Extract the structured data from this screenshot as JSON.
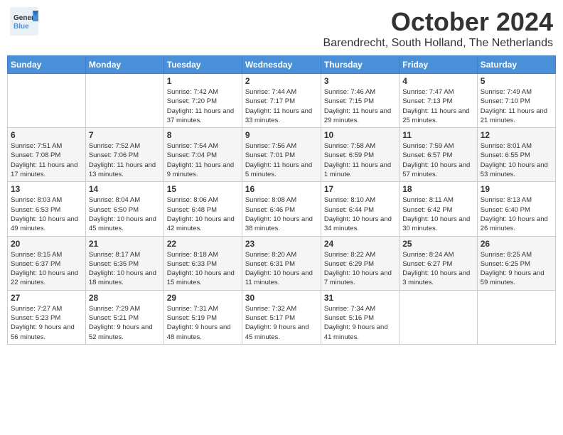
{
  "header": {
    "logo_general": "General",
    "logo_blue": "Blue",
    "month_title": "October 2024",
    "location": "Barendrecht, South Holland, The Netherlands"
  },
  "days_of_week": [
    "Sunday",
    "Monday",
    "Tuesday",
    "Wednesday",
    "Thursday",
    "Friday",
    "Saturday"
  ],
  "weeks": [
    [
      {
        "day": "",
        "sunrise": "",
        "sunset": "",
        "daylight": ""
      },
      {
        "day": "",
        "sunrise": "",
        "sunset": "",
        "daylight": ""
      },
      {
        "day": "1",
        "sunrise": "Sunrise: 7:42 AM",
        "sunset": "Sunset: 7:20 PM",
        "daylight": "Daylight: 11 hours and 37 minutes."
      },
      {
        "day": "2",
        "sunrise": "Sunrise: 7:44 AM",
        "sunset": "Sunset: 7:17 PM",
        "daylight": "Daylight: 11 hours and 33 minutes."
      },
      {
        "day": "3",
        "sunrise": "Sunrise: 7:46 AM",
        "sunset": "Sunset: 7:15 PM",
        "daylight": "Daylight: 11 hours and 29 minutes."
      },
      {
        "day": "4",
        "sunrise": "Sunrise: 7:47 AM",
        "sunset": "Sunset: 7:13 PM",
        "daylight": "Daylight: 11 hours and 25 minutes."
      },
      {
        "day": "5",
        "sunrise": "Sunrise: 7:49 AM",
        "sunset": "Sunset: 7:10 PM",
        "daylight": "Daylight: 11 hours and 21 minutes."
      }
    ],
    [
      {
        "day": "6",
        "sunrise": "Sunrise: 7:51 AM",
        "sunset": "Sunset: 7:08 PM",
        "daylight": "Daylight: 11 hours and 17 minutes."
      },
      {
        "day": "7",
        "sunrise": "Sunrise: 7:52 AM",
        "sunset": "Sunset: 7:06 PM",
        "daylight": "Daylight: 11 hours and 13 minutes."
      },
      {
        "day": "8",
        "sunrise": "Sunrise: 7:54 AM",
        "sunset": "Sunset: 7:04 PM",
        "daylight": "Daylight: 11 hours and 9 minutes."
      },
      {
        "day": "9",
        "sunrise": "Sunrise: 7:56 AM",
        "sunset": "Sunset: 7:01 PM",
        "daylight": "Daylight: 11 hours and 5 minutes."
      },
      {
        "day": "10",
        "sunrise": "Sunrise: 7:58 AM",
        "sunset": "Sunset: 6:59 PM",
        "daylight": "Daylight: 11 hours and 1 minute."
      },
      {
        "day": "11",
        "sunrise": "Sunrise: 7:59 AM",
        "sunset": "Sunset: 6:57 PM",
        "daylight": "Daylight: 10 hours and 57 minutes."
      },
      {
        "day": "12",
        "sunrise": "Sunrise: 8:01 AM",
        "sunset": "Sunset: 6:55 PM",
        "daylight": "Daylight: 10 hours and 53 minutes."
      }
    ],
    [
      {
        "day": "13",
        "sunrise": "Sunrise: 8:03 AM",
        "sunset": "Sunset: 6:53 PM",
        "daylight": "Daylight: 10 hours and 49 minutes."
      },
      {
        "day": "14",
        "sunrise": "Sunrise: 8:04 AM",
        "sunset": "Sunset: 6:50 PM",
        "daylight": "Daylight: 10 hours and 45 minutes."
      },
      {
        "day": "15",
        "sunrise": "Sunrise: 8:06 AM",
        "sunset": "Sunset: 6:48 PM",
        "daylight": "Daylight: 10 hours and 42 minutes."
      },
      {
        "day": "16",
        "sunrise": "Sunrise: 8:08 AM",
        "sunset": "Sunset: 6:46 PM",
        "daylight": "Daylight: 10 hours and 38 minutes."
      },
      {
        "day": "17",
        "sunrise": "Sunrise: 8:10 AM",
        "sunset": "Sunset: 6:44 PM",
        "daylight": "Daylight: 10 hours and 34 minutes."
      },
      {
        "day": "18",
        "sunrise": "Sunrise: 8:11 AM",
        "sunset": "Sunset: 6:42 PM",
        "daylight": "Daylight: 10 hours and 30 minutes."
      },
      {
        "day": "19",
        "sunrise": "Sunrise: 8:13 AM",
        "sunset": "Sunset: 6:40 PM",
        "daylight": "Daylight: 10 hours and 26 minutes."
      }
    ],
    [
      {
        "day": "20",
        "sunrise": "Sunrise: 8:15 AM",
        "sunset": "Sunset: 6:37 PM",
        "daylight": "Daylight: 10 hours and 22 minutes."
      },
      {
        "day": "21",
        "sunrise": "Sunrise: 8:17 AM",
        "sunset": "Sunset: 6:35 PM",
        "daylight": "Daylight: 10 hours and 18 minutes."
      },
      {
        "day": "22",
        "sunrise": "Sunrise: 8:18 AM",
        "sunset": "Sunset: 6:33 PM",
        "daylight": "Daylight: 10 hours and 15 minutes."
      },
      {
        "day": "23",
        "sunrise": "Sunrise: 8:20 AM",
        "sunset": "Sunset: 6:31 PM",
        "daylight": "Daylight: 10 hours and 11 minutes."
      },
      {
        "day": "24",
        "sunrise": "Sunrise: 8:22 AM",
        "sunset": "Sunset: 6:29 PM",
        "daylight": "Daylight: 10 hours and 7 minutes."
      },
      {
        "day": "25",
        "sunrise": "Sunrise: 8:24 AM",
        "sunset": "Sunset: 6:27 PM",
        "daylight": "Daylight: 10 hours and 3 minutes."
      },
      {
        "day": "26",
        "sunrise": "Sunrise: 8:25 AM",
        "sunset": "Sunset: 6:25 PM",
        "daylight": "Daylight: 9 hours and 59 minutes."
      }
    ],
    [
      {
        "day": "27",
        "sunrise": "Sunrise: 7:27 AM",
        "sunset": "Sunset: 5:23 PM",
        "daylight": "Daylight: 9 hours and 56 minutes."
      },
      {
        "day": "28",
        "sunrise": "Sunrise: 7:29 AM",
        "sunset": "Sunset: 5:21 PM",
        "daylight": "Daylight: 9 hours and 52 minutes."
      },
      {
        "day": "29",
        "sunrise": "Sunrise: 7:31 AM",
        "sunset": "Sunset: 5:19 PM",
        "daylight": "Daylight: 9 hours and 48 minutes."
      },
      {
        "day": "30",
        "sunrise": "Sunrise: 7:32 AM",
        "sunset": "Sunset: 5:17 PM",
        "daylight": "Daylight: 9 hours and 45 minutes."
      },
      {
        "day": "31",
        "sunrise": "Sunrise: 7:34 AM",
        "sunset": "Sunset: 5:16 PM",
        "daylight": "Daylight: 9 hours and 41 minutes."
      },
      {
        "day": "",
        "sunrise": "",
        "sunset": "",
        "daylight": ""
      },
      {
        "day": "",
        "sunrise": "",
        "sunset": "",
        "daylight": ""
      }
    ]
  ]
}
